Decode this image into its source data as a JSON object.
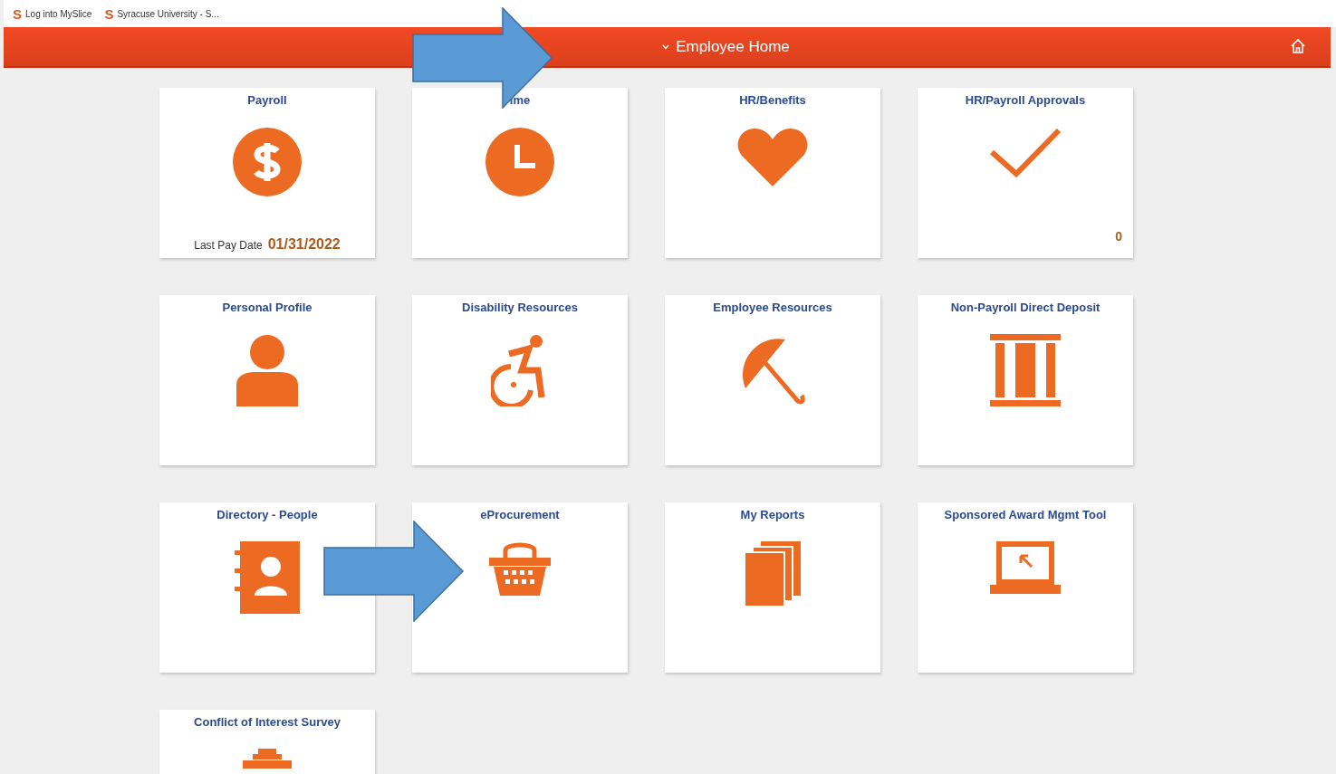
{
  "bookmarks": [
    {
      "icon": "S",
      "label": "Log into MySlice"
    },
    {
      "icon": "S",
      "label": "Syracuse University - S..."
    }
  ],
  "header": {
    "title": "Employee Home"
  },
  "tiles": [
    {
      "title": "Payroll",
      "footer_label": "Last Pay Date",
      "footer_value": "01/31/2022"
    },
    {
      "title": "ime"
    },
    {
      "title": "HR/Benefits"
    },
    {
      "title": "HR/Payroll Approvals",
      "count": "0"
    },
    {
      "title": "Personal Profile"
    },
    {
      "title": "Disability Resources"
    },
    {
      "title": "Employee Resources"
    },
    {
      "title": "Non-Payroll Direct Deposit"
    },
    {
      "title": "Directory - People"
    },
    {
      "title": "eProcurement"
    },
    {
      "title": "My Reports"
    },
    {
      "title": "Sponsored Award Mgmt Tool"
    },
    {
      "title": "Conflict of Interest Survey"
    }
  ]
}
